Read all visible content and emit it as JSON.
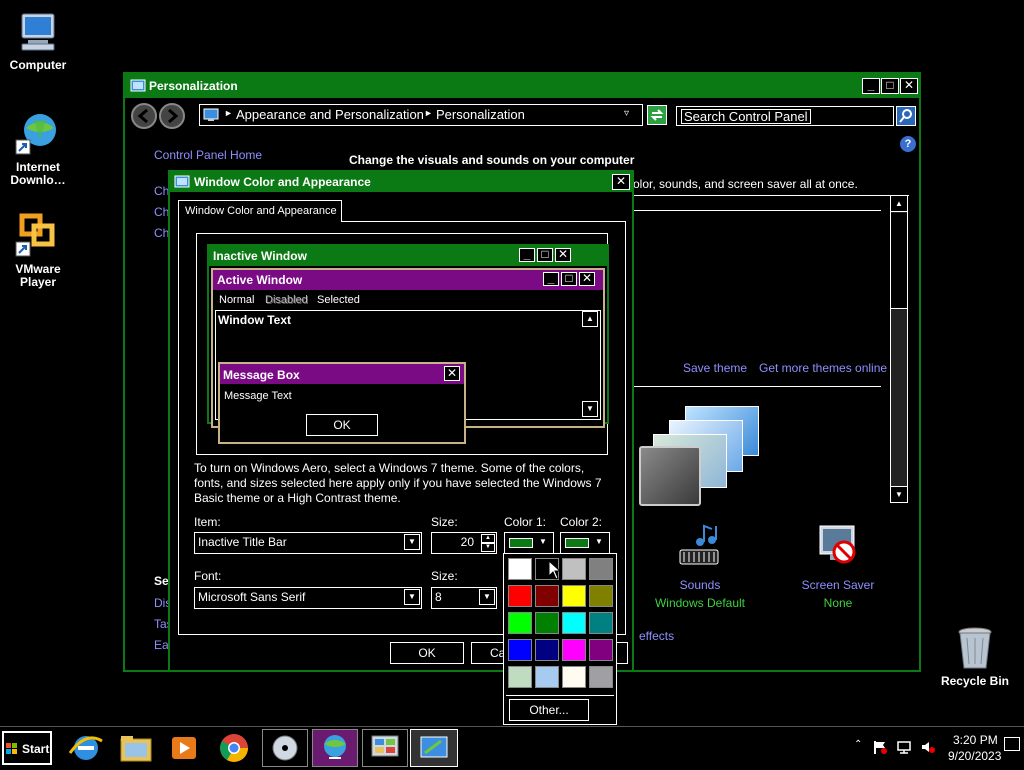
{
  "desktop": {
    "icons": [
      {
        "label": "Computer"
      },
      {
        "label": "Internet Downlo…"
      },
      {
        "label": "VMware Player"
      },
      {
        "label": "Recycle Bin"
      }
    ]
  },
  "personalization": {
    "title": "Personalization",
    "breadcrumb": [
      "Appearance and Personalization",
      "Personalization"
    ],
    "search_placeholder": "Search Control Panel",
    "control_panel_home": "Control Panel Home",
    "heading": "Change the visuals and sounds on your computer",
    "subheading": "olor, sounds, and screen saver all at once.",
    "left_links": [
      "Cha",
      "Cha",
      "Cha"
    ],
    "see_also": "Se",
    "see_also_links": [
      "Dis",
      "Tas",
      "Eas"
    ],
    "save_theme": "Save theme",
    "get_more_themes": "Get more themes online",
    "sounds_label": "Sounds",
    "sounds_value": "Windows Default",
    "screensaver_label": "Screen Saver",
    "screensaver_value": "None",
    "effects_link": "effects"
  },
  "dialog": {
    "title": "Window Color and Appearance",
    "tab_label": "Window Color and Appearance",
    "preview": {
      "inactive_title": "Inactive Window",
      "active_title": "Active Window",
      "menu": [
        "Normal",
        "Disabled",
        "Selected"
      ],
      "window_text": "Window Text",
      "msgbox_title": "Message Box",
      "msgbox_text": "Message Text",
      "ok": "OK"
    },
    "info_lines": [
      "To turn on Windows Aero, select a Windows 7 theme.  Some of the colors,",
      "fonts, and sizes selected here apply only if you have selected the Windows 7",
      "Basic theme or a High Contrast theme."
    ],
    "item_label": "Item:",
    "item_value": "Inactive Title Bar",
    "size_label": "Size:",
    "size_value": "20",
    "color1_label": "Color 1:",
    "color2_label": "Color 2:",
    "font_label": "Font:",
    "font_value": "Microsoft Sans Serif",
    "font_size_label": "Size:",
    "font_size_value": "8",
    "ok_button": "OK",
    "cancel_button": "Ca",
    "color1": "#0c7a14",
    "color2": "#0c7a14"
  },
  "color_picker": {
    "colors": [
      "#ffffff",
      "#000000",
      "#c0c0c0",
      "#808080",
      "#ff0000",
      "#800000",
      "#ffff00",
      "#808000",
      "#00ff00",
      "#008000",
      "#00ffff",
      "#008080",
      "#0000ff",
      "#000080",
      "#ff00ff",
      "#800080",
      "#c0dcc0",
      "#a6caf0",
      "#fffbf0",
      "#a0a0a4"
    ],
    "other_button": "Other..."
  },
  "taskbar": {
    "start": "Start",
    "time": "3:20 PM",
    "date": "9/20/2023"
  }
}
